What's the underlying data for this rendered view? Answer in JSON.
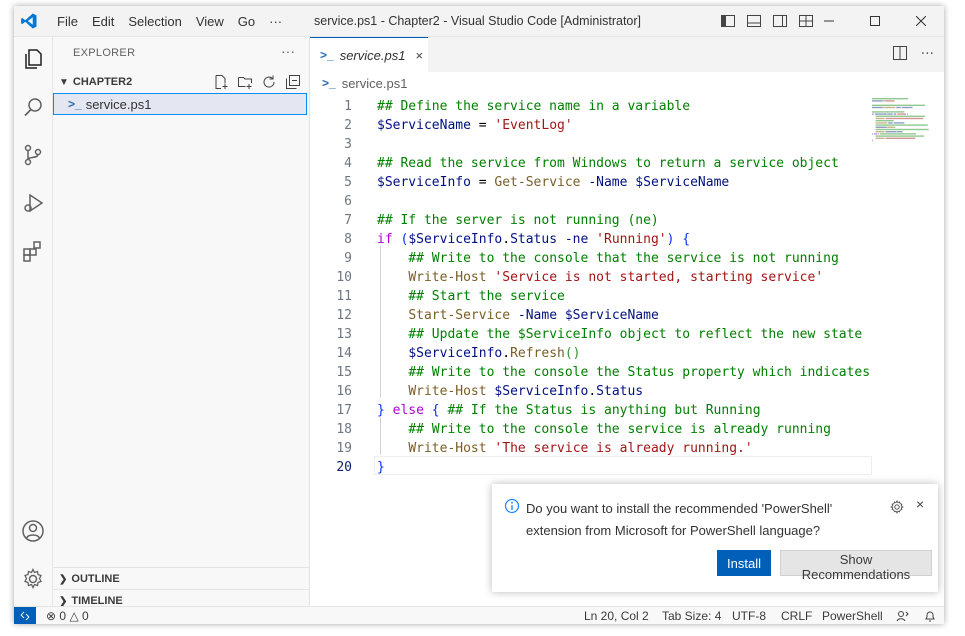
{
  "window": {
    "title": "service.ps1 - Chapter2 - Visual Studio Code [Administrator]",
    "menu": [
      "File",
      "Edit",
      "Selection",
      "View",
      "Go",
      "···"
    ]
  },
  "sidebar": {
    "header": "EXPLORER",
    "more": "···",
    "folder": "CHAPTER2",
    "file": "service.ps1",
    "outline": "OUTLINE",
    "timeline": "TIMELINE"
  },
  "editor": {
    "tab_label": "service.ps1",
    "tab_close": "×",
    "breadcrumb": "service.ps1",
    "active_line": 20,
    "colors": {
      "comment": "#008000",
      "variable": "#001080",
      "string": "#a31515",
      "command": "#795e26",
      "keyword": "#af00db"
    },
    "lines": [
      [
        [
          "c",
          "## Define the service name in a variable"
        ]
      ],
      [
        [
          "v",
          "$ServiceName"
        ],
        [
          "o",
          " = "
        ],
        [
          "s",
          "'EventLog'"
        ]
      ],
      [],
      [
        [
          "c",
          "## Read the service from Windows to return a service object"
        ]
      ],
      [
        [
          "v",
          "$ServiceInfo"
        ],
        [
          "o",
          " = "
        ],
        [
          "f",
          "Get-Service"
        ],
        [
          "o",
          " "
        ],
        [
          "p",
          "-Name"
        ],
        [
          "o",
          " "
        ],
        [
          "v",
          "$ServiceName"
        ]
      ],
      [],
      [
        [
          "c",
          "## If the server is not running (ne)"
        ]
      ],
      [
        [
          "k",
          "if"
        ],
        [
          "o",
          " "
        ],
        [
          "b",
          "("
        ],
        [
          "v",
          "$ServiceInfo"
        ],
        [
          "o",
          "."
        ],
        [
          "p",
          "Status"
        ],
        [
          "o",
          " "
        ],
        [
          "p",
          "-ne"
        ],
        [
          "o",
          " "
        ],
        [
          "s",
          "'Running'"
        ],
        [
          "b",
          ")"
        ],
        [
          "o",
          " "
        ],
        [
          "b",
          "{"
        ]
      ],
      [
        [
          "o",
          "    "
        ],
        [
          "c",
          "## Write to the console that the service is not running"
        ]
      ],
      [
        [
          "o",
          "    "
        ],
        [
          "f",
          "Write-Host"
        ],
        [
          "o",
          " "
        ],
        [
          "s",
          "'Service is not started, starting service'"
        ]
      ],
      [
        [
          "o",
          "    "
        ],
        [
          "c",
          "## Start the service"
        ]
      ],
      [
        [
          "o",
          "    "
        ],
        [
          "f",
          "Start-Service"
        ],
        [
          "o",
          " "
        ],
        [
          "p",
          "-Name"
        ],
        [
          "o",
          " "
        ],
        [
          "v",
          "$ServiceName"
        ]
      ],
      [
        [
          "o",
          "    "
        ],
        [
          "c",
          "## Update the $ServiceInfo object to reflect the new state"
        ]
      ],
      [
        [
          "o",
          "    "
        ],
        [
          "v",
          "$ServiceInfo"
        ],
        [
          "o",
          "."
        ],
        [
          "f",
          "Refresh"
        ],
        [
          "b2",
          "()"
        ]
      ],
      [
        [
          "o",
          "    "
        ],
        [
          "c",
          "## Write to the console the Status property which indicates"
        ]
      ],
      [
        [
          "o",
          "    "
        ],
        [
          "f",
          "Write-Host"
        ],
        [
          "o",
          " "
        ],
        [
          "v",
          "$ServiceInfo"
        ],
        [
          "o",
          "."
        ],
        [
          "p",
          "Status"
        ]
      ],
      [
        [
          "b",
          "}"
        ],
        [
          "o",
          " "
        ],
        [
          "k",
          "else"
        ],
        [
          "o",
          " "
        ],
        [
          "b",
          "{"
        ],
        [
          "o",
          " "
        ],
        [
          "c",
          "## If the Status is anything but Running"
        ]
      ],
      [
        [
          "o",
          "    "
        ],
        [
          "c",
          "## Write to the console the service is already running"
        ]
      ],
      [
        [
          "o",
          "    "
        ],
        [
          "f",
          "Write-Host"
        ],
        [
          "o",
          " "
        ],
        [
          "s",
          "'The service is already running.'"
        ]
      ],
      [
        [
          "b",
          "}"
        ]
      ]
    ]
  },
  "notification": {
    "message": "Do you want to install the recommended 'PowerShell' extension from Microsoft for PowerShell language?",
    "install_label": "Install",
    "recommendations_label": "Show Recommendations",
    "close": "×"
  },
  "status": {
    "errors": "0",
    "warnings": "0",
    "position": "Ln 20, Col 2",
    "tab_size": "Tab Size: 4",
    "encoding": "UTF-8",
    "eol": "CRLF",
    "language": "PowerShell"
  }
}
